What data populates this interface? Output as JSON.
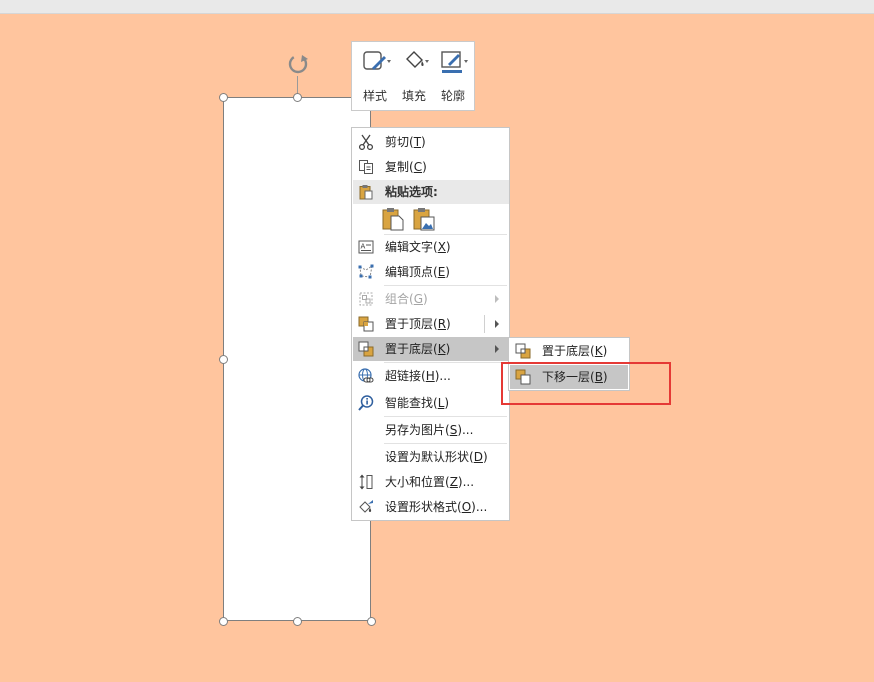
{
  "mini_toolbar": {
    "style_label": "样式",
    "fill_label": "填充",
    "outline_label": "轮廓"
  },
  "context_menu": {
    "cut": {
      "text": "剪切(",
      "key": "T",
      "end": ")"
    },
    "copy": {
      "text": "复制(",
      "key": "C",
      "end": ")"
    },
    "paste_options_header": "粘贴选项:",
    "edit_text": {
      "text": "编辑文字(",
      "key": "X",
      "end": ")"
    },
    "edit_points": {
      "text": "编辑顶点(",
      "key": "E",
      "end": ")"
    },
    "group": {
      "text": "组合(",
      "key": "G",
      "end": ")"
    },
    "bring_to_front": {
      "text": "置于顶层(",
      "key": "R",
      "end": ")"
    },
    "send_to_back": {
      "text": "置于底层(",
      "key": "K",
      "end": ")"
    },
    "hyperlink": {
      "text": "超链接(",
      "key": "H",
      "end": ")..."
    },
    "smart_lookup": {
      "text": "智能查找(",
      "key": "L",
      "end": ")"
    },
    "save_as_picture": {
      "text": "另存为图片(",
      "key": "S",
      "end": ")..."
    },
    "set_default_shape": {
      "text": "设置为默认形状(",
      "key": "D",
      "end": ")"
    },
    "size_position": {
      "text": "大小和位置(",
      "key": "Z",
      "end": ")..."
    },
    "format_shape": {
      "text": "设置形状格式(",
      "key": "O",
      "end": ")..."
    }
  },
  "submenu": {
    "send_to_back": {
      "text": "置于底层(",
      "key": "K",
      "end": ")"
    },
    "send_backward": {
      "text": "下移一层(",
      "key": "B",
      "end": ")"
    }
  },
  "colors": {
    "canvas": "#FFC59E",
    "highlight": "#C6C6C6",
    "annotation_box": "#E53935"
  }
}
